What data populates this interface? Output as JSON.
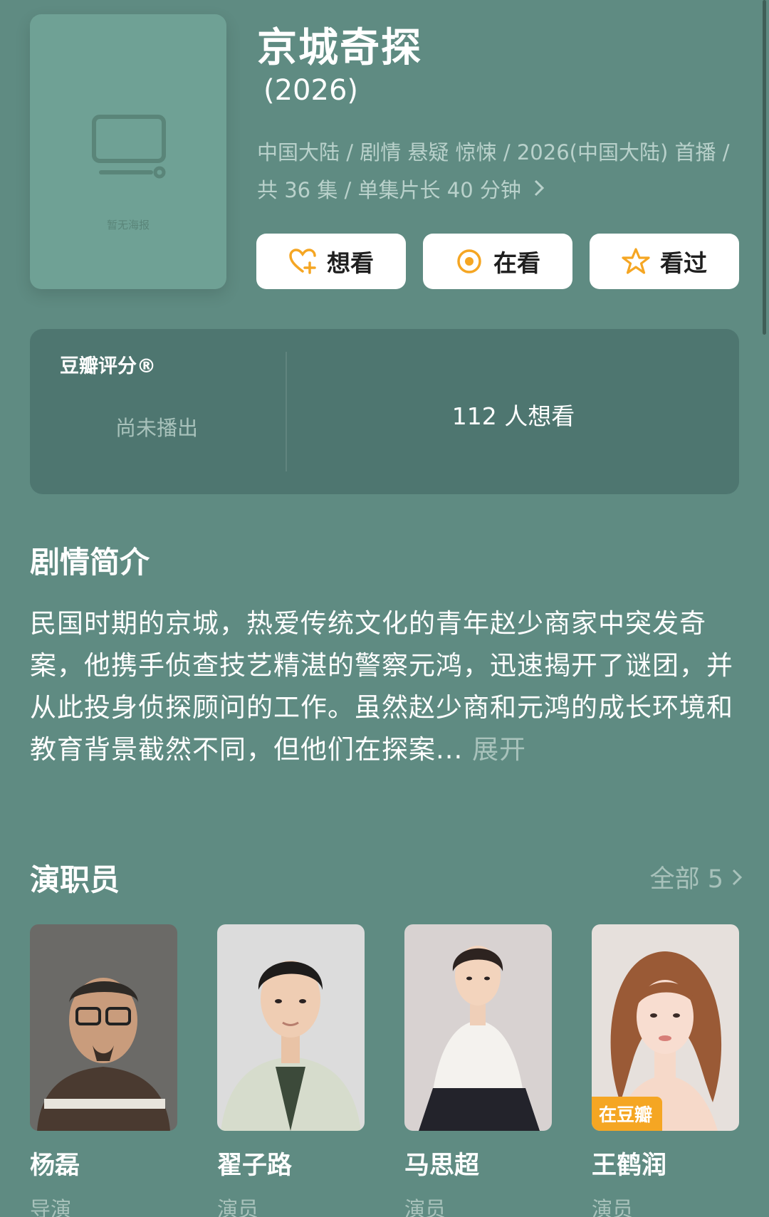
{
  "poster": {
    "placeholder": "暂无海报"
  },
  "title": "京城奇探",
  "year": "(2026)",
  "meta": {
    "line1": "中国大陆 / 剧情 悬疑 惊悚 / 2026(中国大陆) 首播 /",
    "line2": "共 36 集 / 单集片长 40 分钟"
  },
  "actions": {
    "want": "想看",
    "watching": "在看",
    "watched": "看过"
  },
  "rating": {
    "label": "豆瓣评分®",
    "status": "尚未播出",
    "wish_count": "112 人想看"
  },
  "synopsis": {
    "title": "剧情简介",
    "text": "民国时期的京城，热爱传统文化的青年赵少商家中突发奇案，他携手侦查技艺精湛的警察元鸿，迅速揭开了谜团，并从此投身侦探顾问的工作。虽然赵少商和元鸿的成长环境和教育背景截然不同，但他们在探案...",
    "expand": "展开"
  },
  "cast": {
    "title": "演职员",
    "all_label": "全部 5",
    "members": [
      {
        "name": "杨磊",
        "role": "导演",
        "badge": ""
      },
      {
        "name": "翟子路",
        "role": "演员",
        "badge": ""
      },
      {
        "name": "马思超",
        "role": "演员",
        "badge": ""
      },
      {
        "name": "王鹤润",
        "role": "演员",
        "badge": "在豆瓣"
      }
    ]
  },
  "colors": {
    "background": "#5f8b82",
    "card": "#4e7670",
    "accent": "#f5a623",
    "muted_text": "#a8c2bb"
  }
}
